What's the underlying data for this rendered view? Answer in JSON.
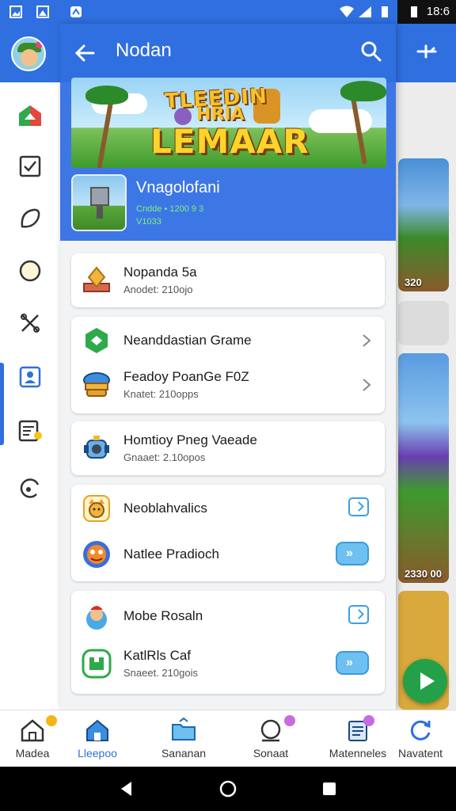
{
  "status_bar": {
    "time": "18:6"
  },
  "header": {
    "title": "Nodan"
  },
  "hero": {
    "banner_line1": "TLEEDIN",
    "banner_line2": "HRIA",
    "banner_logo": "LEMAAR",
    "app_name": "Vnagolofani",
    "meta_line1": "Cndde • 1200 9 3",
    "meta_line2": "V1033"
  },
  "cards": [
    {
      "rows": [
        {
          "title": "Nopanda 5a",
          "subtitle": "Anodet: 210ojo",
          "icon": "gem-icon",
          "action": "none"
        }
      ]
    },
    {
      "rows": [
        {
          "title": "Neanddastian Grame",
          "subtitle": "",
          "icon": "green-shield-icon",
          "action": "chevron"
        },
        {
          "title": "Feadoy PoanGe F0Z",
          "subtitle": "Knatet: 210opps",
          "icon": "burger-icon",
          "action": "chevron"
        }
      ]
    },
    {
      "rows": [
        {
          "title": "Homtioy Pneg Vaeade",
          "subtitle": "Gnaaet: 2.10opos",
          "icon": "robot-icon",
          "action": "none"
        }
      ]
    },
    {
      "rows": [
        {
          "title": "Neoblahvalics",
          "subtitle": "",
          "icon": "cat-icon",
          "action": "outline"
        },
        {
          "title": "Natlee Pradioch",
          "subtitle": "",
          "icon": "monster-icon",
          "action": "pill"
        }
      ]
    },
    {
      "rows": [
        {
          "title": "Mobe Rosaln",
          "subtitle": "",
          "icon": "character-icon",
          "action": "outline"
        },
        {
          "title": "KatlRls Caf",
          "subtitle": "Snaeet. 210gois",
          "icon": "green-puzzle-icon",
          "action": "pill"
        }
      ]
    }
  ],
  "background": {
    "tile1_label": "320",
    "tile3_label": "2330 00"
  },
  "bottom_nav": [
    {
      "label": "Madea",
      "icon": "home-outline-icon"
    },
    {
      "label": "Lleepoo",
      "icon": "home-icon"
    },
    {
      "label": "Sananan",
      "icon": "folder-icon"
    },
    {
      "label": "Sonaat",
      "icon": "chat-icon"
    },
    {
      "label": "Matenneles",
      "icon": "document-icon"
    },
    {
      "label": "Navatent",
      "icon": "refresh-icon"
    }
  ],
  "colors": {
    "primary": "#2f6fe0",
    "hero": "#3d77e6",
    "accent": "#3aa0e6",
    "fab": "#24a148"
  }
}
